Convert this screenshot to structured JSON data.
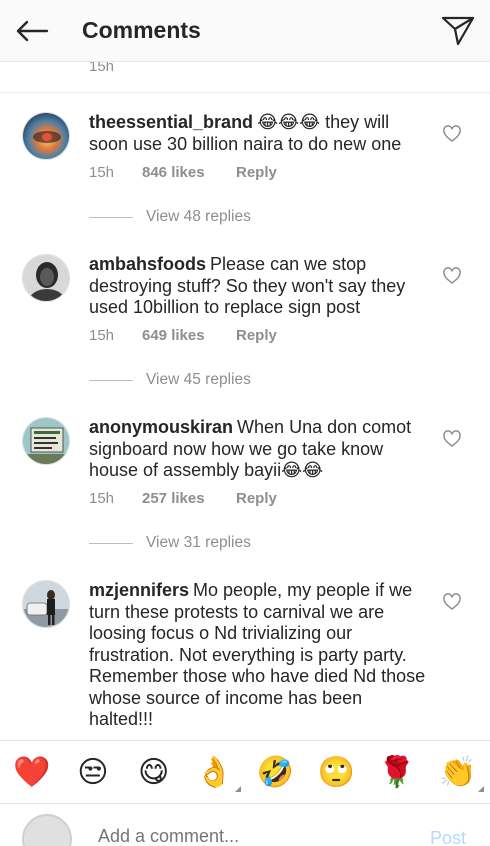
{
  "header": {
    "title": "Comments"
  },
  "previous": {
    "time": "15h"
  },
  "comments": [
    {
      "username": "theessential_brand",
      "text": "😂😂😂 they will soon use 30 billion naira to do new one",
      "time": "15h",
      "likes": "846 likes",
      "reply": "Reply",
      "view_replies": "View 48 replies"
    },
    {
      "username": "ambahsfoods",
      "text": "Please can we stop destroying stuff? So they won't say they used 10billion to replace sign post",
      "time": "15h",
      "likes": "649 likes",
      "reply": "Reply",
      "view_replies": "View 45 replies"
    },
    {
      "username": "anonymouskiran",
      "text": "When Una don comot signboard now how we go take know house of assembly bayii😂😂",
      "time": "15h",
      "likes": "257 likes",
      "reply": "Reply",
      "view_replies": "View 31 replies"
    },
    {
      "username": "mzjennifers",
      "text": "Mo people, my people if we turn these protests to carnival we are loosing focus o Nd trivializing our frustration. Not everything is party party. Remember those who have died Nd those whose source of income has been halted!!!"
    }
  ],
  "emojis": [
    {
      "char": "❤️",
      "name": "red-heart"
    },
    {
      "char": "😒",
      "name": "unamused-face"
    },
    {
      "char": "😋",
      "name": "yum-face"
    },
    {
      "char": "👌",
      "name": "ok-hand"
    },
    {
      "char": "🤣",
      "name": "rofl-face"
    },
    {
      "char": "🙄",
      "name": "eye-roll-face"
    },
    {
      "char": "🌹",
      "name": "rose"
    },
    {
      "char": "👏",
      "name": "clapping-hands"
    }
  ],
  "input": {
    "placeholder": "Add a comment...",
    "post_label": "Post"
  },
  "colors": {
    "text": "#262626",
    "secondary": "#8e8e8e",
    "post_disabled": "#b3dbff"
  }
}
